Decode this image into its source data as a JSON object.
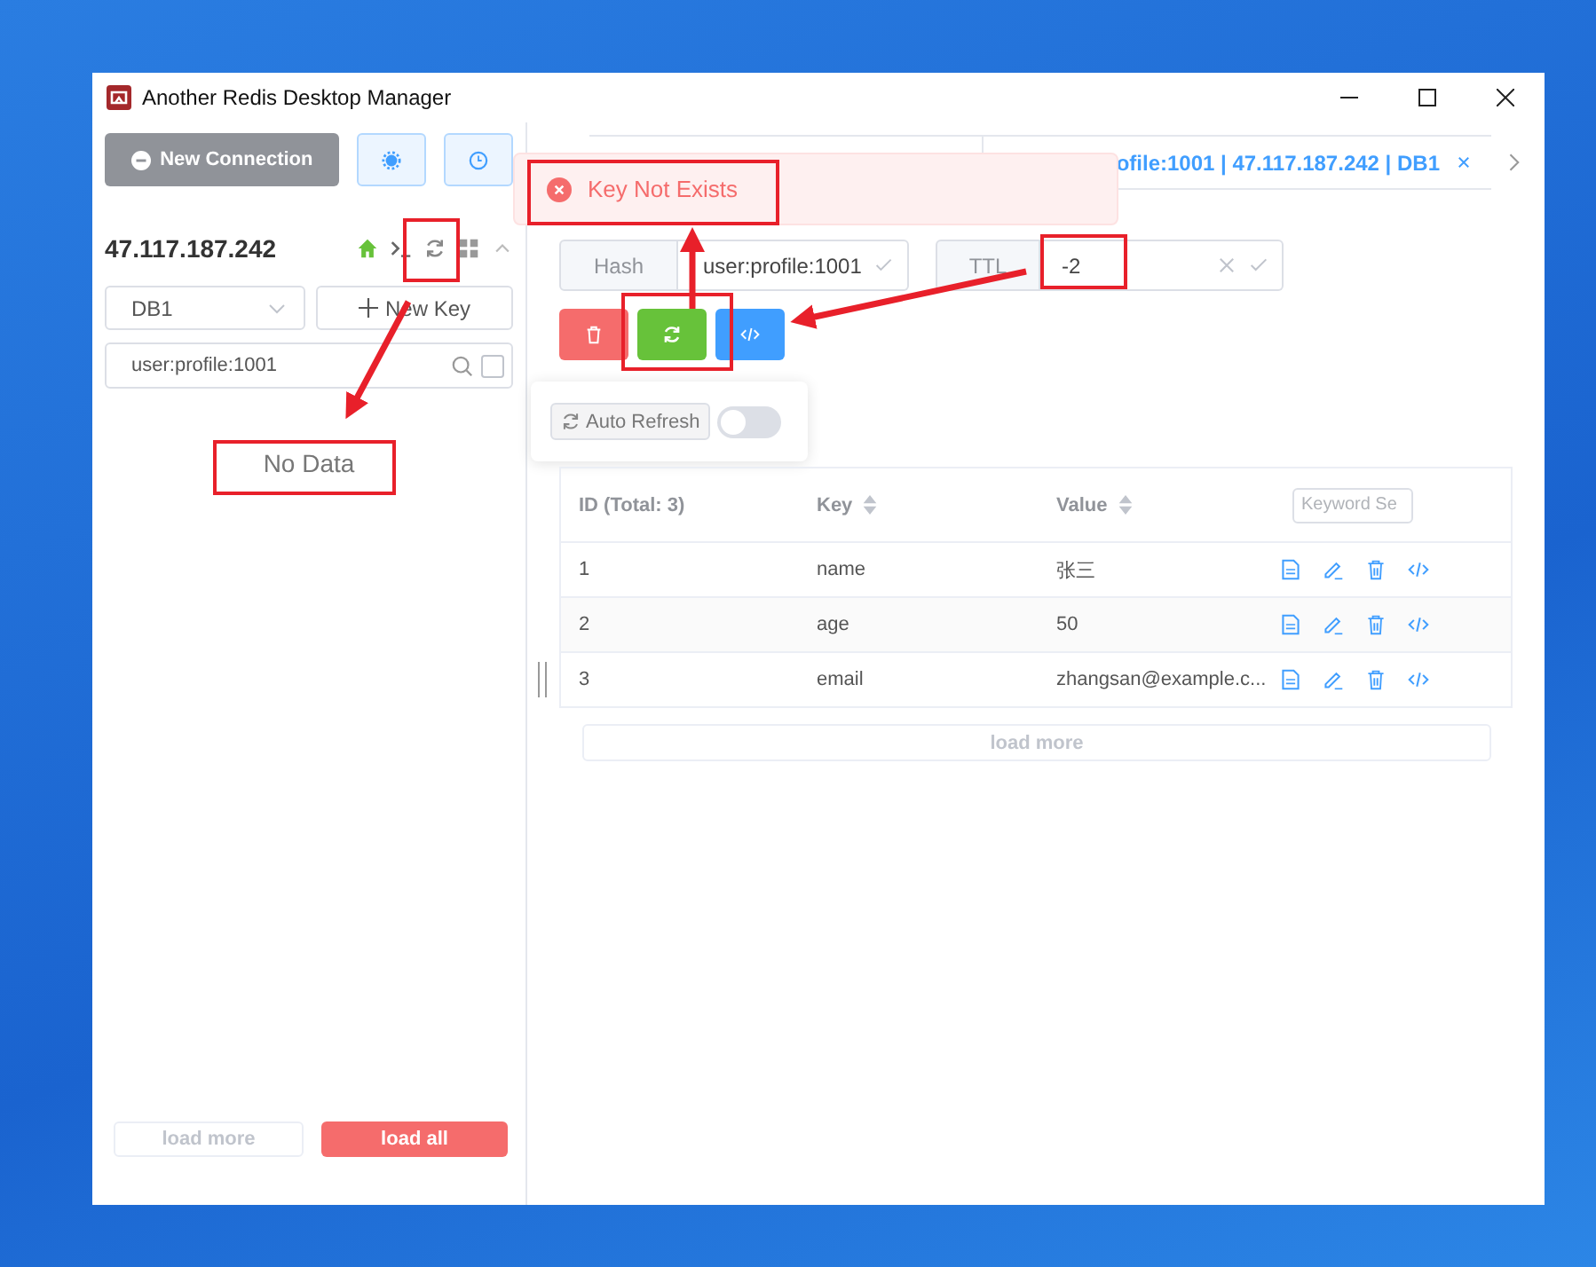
{
  "window": {
    "title": "Another Redis Desktop Manager"
  },
  "sidebar": {
    "new_connection": "New Connection",
    "host": "47.117.187.242",
    "db_select": {
      "value": "DB1"
    },
    "new_key": "New Key",
    "search": {
      "value": "user:profile:1001",
      "checked": false
    },
    "empty_text": "No Data",
    "footer_buttons": [
      {
        "label": "load more",
        "kind": "plain"
      },
      {
        "label": "load all",
        "kind": "danger"
      }
    ]
  },
  "tab": {
    "label": "ofile:1001 | 47.117.187.242 | DB1"
  },
  "toast": {
    "message": "Key Not Exists"
  },
  "key_info": {
    "type": "Hash",
    "name": "user:profile:1001",
    "ttl_label": "TTL",
    "ttl": "-2"
  },
  "auto_refresh": {
    "label": "Auto Refresh",
    "on": false
  },
  "table": {
    "columns": [
      {
        "label": "ID (Total: 3)",
        "sortable": false
      },
      {
        "label": "Key",
        "sortable": true
      },
      {
        "label": "Value",
        "sortable": true
      }
    ],
    "search": {
      "placeholder": "Keyword Se"
    },
    "rows": [
      {
        "id": "1",
        "key": "name",
        "value": "张三"
      },
      {
        "id": "2",
        "key": "age",
        "value": "50"
      },
      {
        "id": "3",
        "key": "email",
        "value": "zhangsan@example.c..."
      }
    ],
    "load_more": "load more"
  }
}
